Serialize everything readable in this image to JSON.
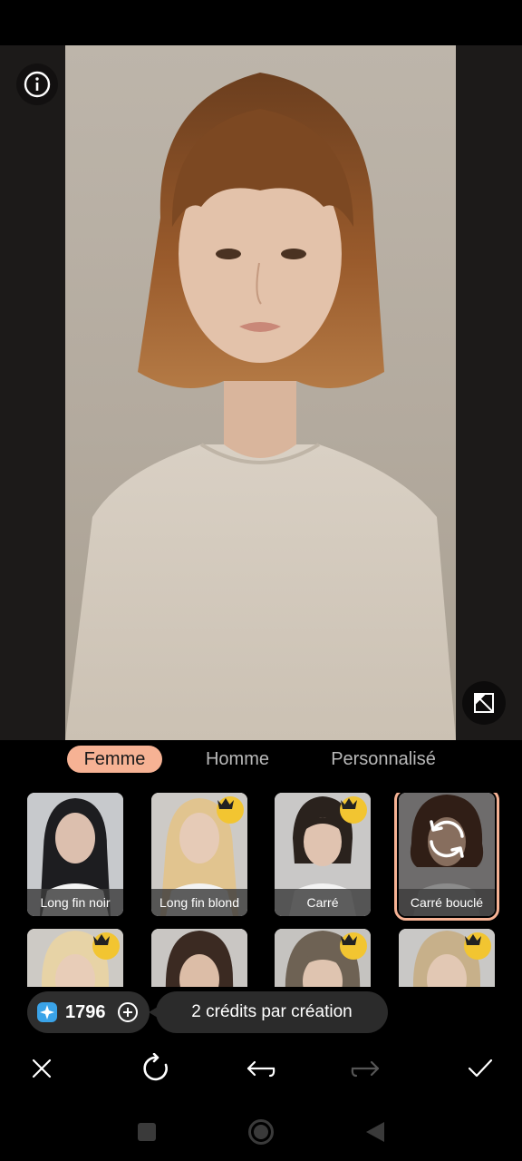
{
  "tabs": [
    {
      "label": "Femme",
      "active": true
    },
    {
      "label": "Homme",
      "active": false
    },
    {
      "label": "Personnalisé",
      "active": false
    }
  ],
  "styles_row1": [
    {
      "label": "Long fin noir",
      "premium": false,
      "selected": false
    },
    {
      "label": "Long fin blond",
      "premium": true,
      "selected": false
    },
    {
      "label": "Carré",
      "premium": true,
      "selected": false
    },
    {
      "label": "Carré bouclé",
      "premium": false,
      "selected": true
    }
  ],
  "styles_row2": [
    {
      "premium": true
    },
    {
      "premium": false
    },
    {
      "premium": true
    },
    {
      "premium": true
    }
  ],
  "credits": {
    "count": "1796",
    "info": "2 crédits par création"
  },
  "colors": {
    "accent": "#f6b294",
    "crown": "#f2c531",
    "background": "#000000"
  },
  "icons": {
    "info": "info-icon",
    "compare": "compare-icon",
    "gem": "gem-icon",
    "add": "plus-circle-icon",
    "close": "close-icon",
    "regenerate": "refresh-icon",
    "undo": "undo-icon",
    "redo": "redo-icon",
    "confirm": "check-icon",
    "nav_recent": "square-icon",
    "nav_home": "circle-icon",
    "nav_back": "triangle-back-icon"
  }
}
